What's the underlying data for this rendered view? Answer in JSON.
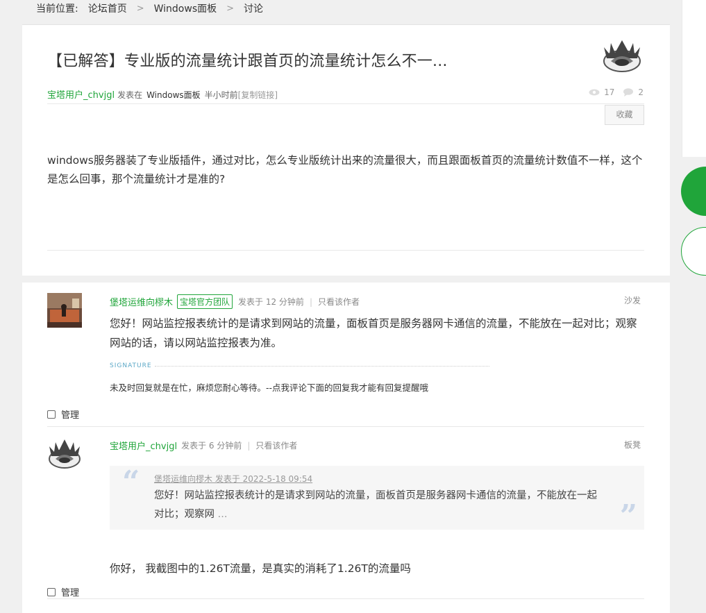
{
  "breadcrumb": {
    "label": "当前位置:",
    "items": [
      "论坛首页",
      "Windows面板",
      "讨论"
    ],
    "separator": ">"
  },
  "thread": {
    "title": "【已解答】专业版的流量统计跟首页的流量统计怎么不一...",
    "author": "宝塔用户_chvjgl",
    "posted_prefix": "发表在",
    "board": "Windows面板",
    "time": "半小时前",
    "copy_link": "[复制链接]",
    "views": "17",
    "replies": "2",
    "favorite_label": "收藏",
    "content": "windows服务器装了专业版插件，通过对比，怎么专业版统计出来的流量很大，而且跟面板首页的流量统计数值不一样，这个是怎么回事，那个流量统计才是准的?"
  },
  "replies": [
    {
      "author": "堡塔运维向樛木",
      "badge": "宝塔官方团队",
      "time": "发表于 12 分钟前",
      "only_author": "只看该作者",
      "floor": "沙发",
      "text": "您好！网站监控报表统计的是请求到网站的流量，面板首页是服务器网卡通信的流量，不能放在一起对比；观察网站的话，请以网站监控报表为准。",
      "signature_label": "SIGNATURE",
      "signature": "未及时回复就是在忙，麻烦您耐心等待。--点我评论下面的回复我才能有回复提醒哦",
      "manage_label": "管理"
    },
    {
      "author": "宝塔用户_chvjgl",
      "time": "发表于 6 分钟前",
      "only_author": "只看该作者",
      "floor": "板凳",
      "quote_head": "堡塔运维向樛木 发表于 2022-5-18 09:54",
      "quote_text": "您好！网站监控报表统计的是请求到网站的流量，面板首页是服务器网卡通信的流量，不能放在一起对比；观察网",
      "quote_ellipsis": " ...",
      "text": "你好， 我截图中的1.26T流量，是真实的消耗了1.26T的流量吗",
      "manage_label": "管理"
    }
  ],
  "colors": {
    "brand_green": "#20a53a",
    "page_bg": "#f0f0f0"
  }
}
